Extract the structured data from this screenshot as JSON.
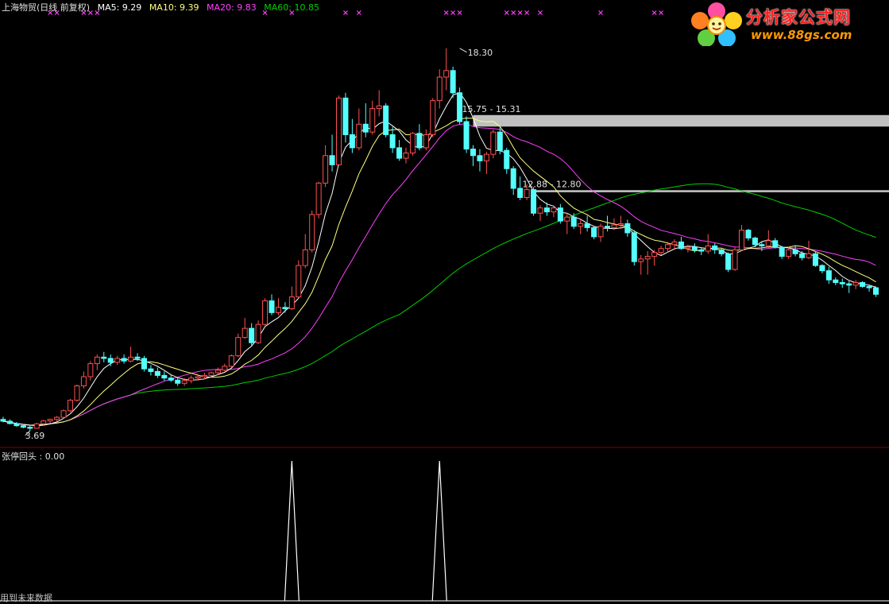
{
  "header": {
    "stock": "上海物贸(日线 前复权)",
    "ma5": "MA5: 9.29",
    "ma10": "MA10: 9.39",
    "ma20": "MA20: 9.83",
    "ma60": "MA60: 10.85"
  },
  "indicator": {
    "label": "张停回头 : 0.00"
  },
  "footer": {
    "text": "用到未来数据"
  },
  "logo": {
    "title": "分析家公式网",
    "url": "www.88gs.com"
  },
  "colors": {
    "up": "#ff5050",
    "down": "#54ffff",
    "ma5": "#ffffff",
    "ma10": "#ffff80",
    "ma20": "#ff40ff",
    "ma60": "#00d000",
    "grid": "#800000",
    "bar": "#c0c0c0",
    "text": "#e0e0e0"
  },
  "chart_data": {
    "type": "candlestick",
    "ylim": [
      3.2,
      19.6
    ],
    "annotations": {
      "high": {
        "label": "18.30",
        "value": 18.3,
        "index": 68
      },
      "low": {
        "label": "3.69",
        "value": 3.69,
        "index": 4
      },
      "zone1": {
        "label": "15.75 - 15.31",
        "top": 15.75,
        "bottom": 15.31,
        "start_index": 70
      },
      "zone2": {
        "label": "12.88 - 12.80",
        "top": 12.88,
        "bottom": 12.8,
        "start_index": 79
      }
    },
    "signal_days": [
      43,
      65
    ],
    "signal_markers": [
      7,
      8,
      12,
      13,
      14,
      39,
      43,
      51,
      53,
      66,
      67,
      68,
      75,
      76,
      77,
      78,
      80,
      89,
      97,
      98
    ],
    "candles": [
      [
        4.12,
        4.22,
        4.01,
        4.05
      ],
      [
        4.05,
        4.12,
        3.93,
        3.96
      ],
      [
        3.96,
        4.02,
        3.84,
        3.88
      ],
      [
        3.88,
        3.94,
        3.78,
        3.82
      ],
      [
        3.82,
        3.9,
        3.69,
        3.78
      ],
      [
        3.78,
        4.0,
        3.76,
        3.95
      ],
      [
        3.95,
        4.1,
        3.9,
        4.06
      ],
      [
        4.06,
        4.15,
        3.98,
        4.12
      ],
      [
        4.12,
        4.25,
        4.05,
        4.2
      ],
      [
        4.2,
        4.5,
        4.15,
        4.45
      ],
      [
        4.45,
        4.9,
        4.4,
        4.85
      ],
      [
        4.85,
        5.45,
        4.8,
        5.4
      ],
      [
        5.4,
        5.95,
        5.3,
        5.75
      ],
      [
        5.75,
        6.35,
        5.6,
        6.25
      ],
      [
        6.25,
        6.6,
        6.0,
        6.5
      ],
      [
        6.5,
        6.7,
        6.3,
        6.45
      ],
      [
        6.45,
        6.6,
        6.15,
        6.3
      ],
      [
        6.3,
        6.55,
        6.2,
        6.45
      ],
      [
        6.45,
        6.6,
        6.25,
        6.35
      ],
      [
        6.35,
        6.9,
        6.3,
        6.5
      ],
      [
        6.5,
        6.65,
        6.35,
        6.45
      ],
      [
        6.45,
        6.55,
        5.95,
        6.05
      ],
      [
        6.05,
        6.2,
        5.8,
        5.95
      ],
      [
        5.95,
        6.1,
        5.7,
        5.8
      ],
      [
        5.8,
        5.95,
        5.6,
        5.7
      ],
      [
        5.7,
        5.82,
        5.55,
        5.62
      ],
      [
        5.62,
        5.75,
        5.4,
        5.5
      ],
      [
        5.5,
        5.7,
        5.4,
        5.6
      ],
      [
        5.6,
        5.8,
        5.5,
        5.7
      ],
      [
        5.7,
        5.85,
        5.6,
        5.75
      ],
      [
        5.75,
        5.9,
        5.65,
        5.8
      ],
      [
        5.8,
        5.95,
        5.7,
        5.9
      ],
      [
        5.9,
        6.1,
        5.8,
        6.0
      ],
      [
        6.0,
        6.25,
        5.95,
        6.15
      ],
      [
        6.15,
        6.6,
        6.1,
        6.55
      ],
      [
        6.55,
        7.4,
        6.5,
        7.25
      ],
      [
        7.25,
        8.0,
        7.2,
        7.6
      ],
      [
        7.6,
        7.8,
        6.95,
        7.05
      ],
      [
        7.05,
        7.9,
        7.0,
        7.75
      ],
      [
        7.75,
        8.75,
        7.7,
        8.65
      ],
      [
        8.65,
        8.9,
        8.1,
        8.2
      ],
      [
        8.2,
        8.75,
        8.1,
        8.4
      ],
      [
        8.4,
        8.6,
        8.2,
        8.35
      ],
      [
        8.35,
        9.2,
        8.3,
        8.8
      ],
      [
        8.8,
        10.2,
        8.75,
        10.0
      ],
      [
        10.0,
        11.2,
        9.9,
        10.6
      ],
      [
        10.6,
        12.1,
        10.5,
        11.95
      ],
      [
        11.95,
        13.2,
        11.8,
        13.15
      ],
      [
        13.15,
        14.6,
        13.0,
        14.2
      ],
      [
        14.2,
        15.0,
        13.6,
        13.85
      ],
      [
        13.85,
        16.5,
        13.8,
        16.4
      ],
      [
        16.4,
        16.6,
        14.7,
        15.0
      ],
      [
        15.0,
        15.6,
        14.3,
        14.5
      ],
      [
        14.5,
        16.0,
        14.4,
        15.4
      ],
      [
        15.4,
        16.2,
        14.9,
        15.1
      ],
      [
        15.1,
        16.3,
        15.0,
        16.0
      ],
      [
        16.0,
        16.7,
        15.7,
        16.1
      ],
      [
        16.1,
        16.2,
        14.9,
        15.0
      ],
      [
        15.0,
        15.3,
        14.3,
        14.5
      ],
      [
        14.5,
        14.8,
        14.0,
        14.1
      ],
      [
        14.1,
        14.5,
        13.9,
        14.3
      ],
      [
        14.3,
        15.1,
        14.2,
        15.05
      ],
      [
        15.05,
        15.4,
        14.4,
        14.5
      ],
      [
        14.5,
        15.2,
        14.4,
        15.0
      ],
      [
        15.0,
        16.4,
        14.9,
        16.3
      ],
      [
        16.3,
        17.5,
        16.0,
        17.2
      ],
      [
        17.2,
        18.3,
        16.7,
        17.45
      ],
      [
        17.45,
        17.6,
        16.4,
        16.6
      ],
      [
        16.6,
        16.8,
        15.4,
        15.5
      ],
      [
        15.5,
        15.7,
        14.3,
        14.45
      ],
      [
        14.45,
        14.6,
        13.8,
        14.2
      ],
      [
        14.2,
        14.45,
        13.6,
        14.0
      ],
      [
        14.0,
        14.35,
        13.5,
        14.25
      ],
      [
        14.25,
        15.2,
        14.1,
        15.1
      ],
      [
        15.1,
        15.3,
        14.25,
        14.4
      ],
      [
        14.4,
        14.5,
        13.5,
        13.7
      ],
      [
        13.7,
        13.8,
        12.7,
        12.95
      ],
      [
        12.95,
        13.4,
        12.5,
        12.6
      ],
      [
        12.6,
        13.1,
        12.5,
        12.9
      ],
      [
        12.9,
        13.0,
        11.9,
        12.0
      ],
      [
        12.0,
        12.3,
        11.7,
        12.2
      ],
      [
        12.2,
        12.4,
        11.9,
        12.05
      ],
      [
        12.05,
        12.3,
        11.85,
        12.2
      ],
      [
        12.2,
        12.35,
        11.6,
        11.7
      ],
      [
        11.7,
        12.0,
        11.2,
        11.85
      ],
      [
        11.85,
        12.0,
        11.4,
        11.5
      ],
      [
        11.5,
        11.8,
        11.2,
        11.6
      ],
      [
        11.6,
        11.9,
        11.3,
        11.45
      ],
      [
        11.45,
        11.5,
        11.0,
        11.1
      ],
      [
        11.1,
        11.6,
        10.9,
        11.5
      ],
      [
        11.5,
        11.9,
        11.3,
        11.45
      ],
      [
        11.45,
        11.8,
        11.35,
        11.55
      ],
      [
        11.55,
        11.9,
        11.4,
        11.6
      ],
      [
        11.6,
        11.75,
        11.1,
        11.25
      ],
      [
        11.25,
        11.35,
        10.0,
        10.15
      ],
      [
        10.15,
        10.4,
        9.65,
        10.25
      ],
      [
        10.25,
        10.55,
        9.65,
        10.35
      ],
      [
        10.35,
        10.6,
        10.0,
        10.5
      ],
      [
        10.5,
        10.75,
        10.4,
        10.65
      ],
      [
        10.65,
        10.9,
        10.5,
        10.8
      ],
      [
        10.8,
        11.0,
        10.6,
        10.9
      ],
      [
        10.9,
        11.1,
        10.6,
        10.65
      ],
      [
        10.65,
        10.8,
        10.5,
        10.7
      ],
      [
        10.7,
        10.85,
        10.5,
        10.6
      ],
      [
        10.6,
        10.7,
        10.4,
        10.55
      ],
      [
        10.55,
        11.2,
        10.45,
        10.75
      ],
      [
        10.75,
        10.85,
        10.45,
        10.6
      ],
      [
        10.6,
        10.65,
        10.35,
        10.45
      ],
      [
        10.45,
        10.5,
        9.75,
        9.85
      ],
      [
        9.85,
        10.7,
        9.8,
        10.6
      ],
      [
        10.6,
        11.55,
        10.55,
        11.35
      ],
      [
        11.35,
        11.4,
        10.95,
        11.05
      ],
      [
        11.05,
        11.1,
        10.7,
        10.8
      ],
      [
        10.8,
        10.9,
        10.55,
        10.75
      ],
      [
        10.75,
        11.35,
        10.65,
        10.95
      ],
      [
        10.95,
        11.05,
        10.65,
        10.7
      ],
      [
        10.7,
        10.75,
        10.25,
        10.35
      ],
      [
        10.35,
        10.7,
        10.25,
        10.6
      ],
      [
        10.6,
        10.75,
        10.35,
        10.45
      ],
      [
        10.45,
        10.55,
        10.2,
        10.3
      ],
      [
        10.3,
        10.95,
        10.25,
        10.45
      ],
      [
        10.45,
        10.55,
        9.95,
        10.0
      ],
      [
        10.0,
        10.05,
        9.7,
        9.8
      ],
      [
        9.8,
        9.95,
        9.3,
        9.45
      ],
      [
        9.45,
        9.55,
        9.25,
        9.35
      ],
      [
        9.35,
        9.5,
        9.15,
        9.3
      ],
      [
        9.3,
        9.4,
        8.95,
        9.25
      ],
      [
        9.25,
        9.45,
        9.1,
        9.35
      ],
      [
        9.35,
        9.4,
        9.15,
        9.2
      ],
      [
        9.2,
        9.25,
        9.0,
        9.15
      ],
      [
        9.15,
        9.2,
        8.8,
        8.9
      ]
    ]
  }
}
